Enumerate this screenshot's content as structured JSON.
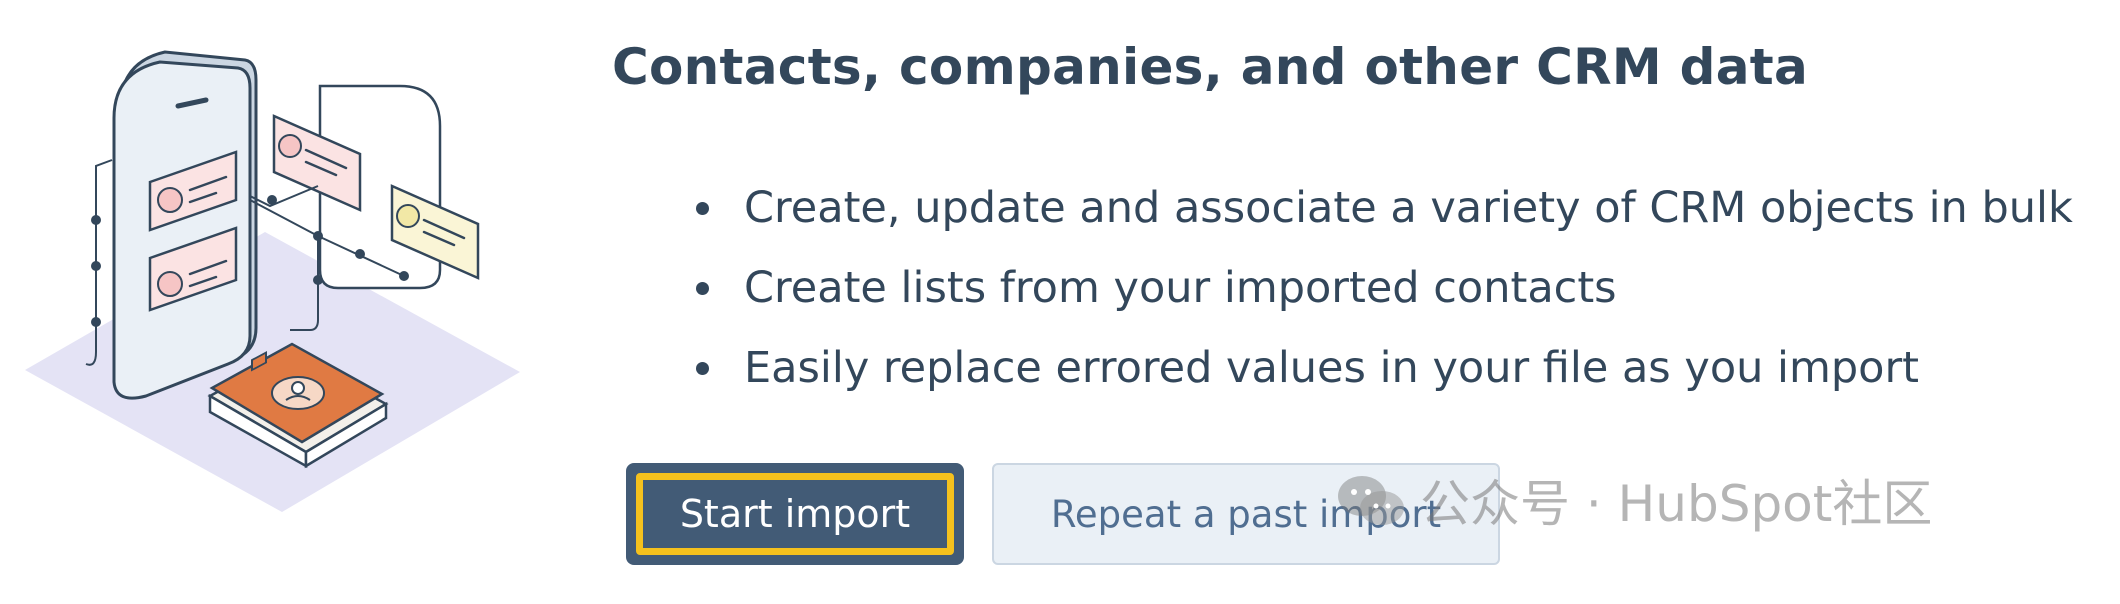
{
  "content": {
    "heading": "Contacts, companies, and other CRM data",
    "bullets": [
      "Create, update and associate a variety of CRM objects in bulk",
      "Create lists from your imported contacts",
      "Easily replace errored values in your file as you import"
    ]
  },
  "actions": {
    "start_import_label": "Start import",
    "repeat_import_label": "Repeat a past import"
  },
  "watermark": {
    "text": "公众号 · HubSpot社区",
    "icon": "wechat-icon"
  },
  "illustration": {
    "icon": "crm-phone-illustration"
  },
  "colors": {
    "text": "#33475b",
    "primary_button": "#425b76",
    "focus_ring": "#f5c11d",
    "secondary_button": "#eaf0f6",
    "book": "#e07a43"
  }
}
